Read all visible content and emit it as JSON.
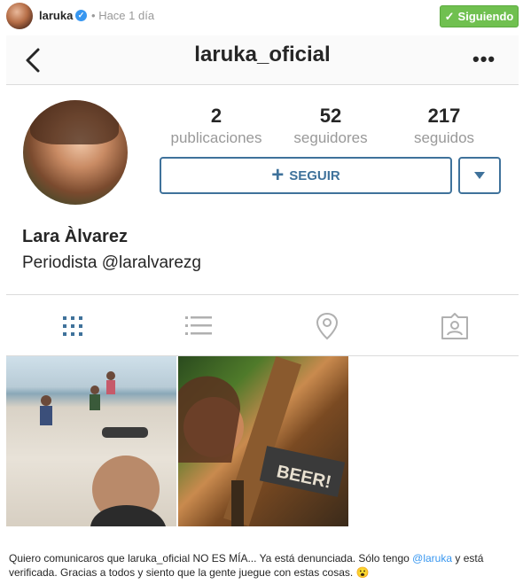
{
  "post": {
    "username": "laruka",
    "separator": "•",
    "time": "Hace 1 día",
    "follow_label": "Siguiendo"
  },
  "profile": {
    "nav_title": "laruka_oficial",
    "stats": [
      {
        "value": "2",
        "label": "publicaciones"
      },
      {
        "value": "52",
        "label": "seguidores"
      },
      {
        "value": "217",
        "label": "seguidos"
      }
    ],
    "follow_button": "SEGUIR",
    "full_name": "Lara Àlvarez",
    "bio": "Periodista @laralvarezg"
  },
  "caption": {
    "part1": "Quiero comunicaros que laruka_oficial NO ES MÍA... Ya está denunciada. Sólo tengo ",
    "mention": "@laruka",
    "part2": " y está verificada. Gracias a todos y siento que la gente juegue con estas cosas. 😮"
  },
  "colors": {
    "follow_green": "#70c050",
    "link_blue": "#3f729b",
    "verified_blue": "#3897f0"
  },
  "icons": [
    "verified-icon",
    "check-icon",
    "back-icon",
    "more-icon",
    "grid-icon",
    "list-icon",
    "location-icon",
    "tagged-icon",
    "plus-icon",
    "chevron-down-icon"
  ]
}
